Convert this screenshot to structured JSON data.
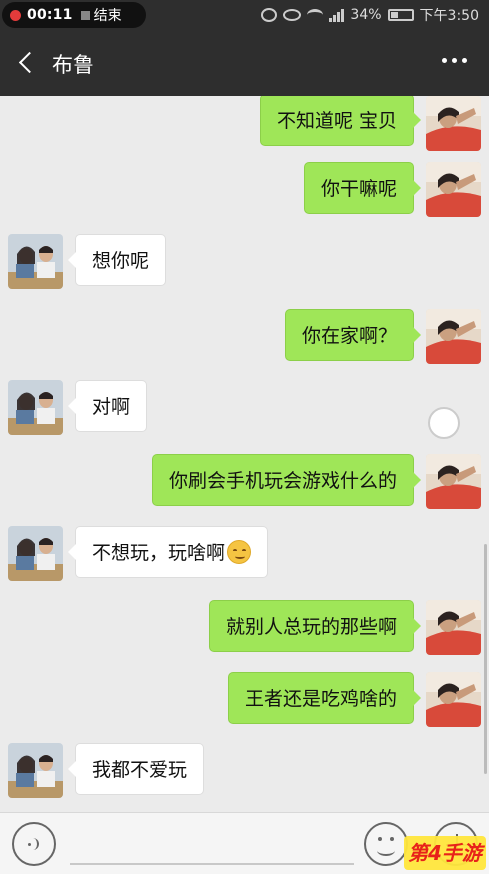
{
  "status_bar": {
    "recording_time": "00:11",
    "recording_end_label": "结束",
    "battery": "34%",
    "clock": "下午3:50",
    "icons": [
      "alarm-icon",
      "eye-icon",
      "wifi-icon",
      "signal-icon",
      "battery-icon"
    ]
  },
  "nav": {
    "title": "布鲁",
    "back_icon": "back-arrow-icon",
    "more_icon": "more-dots-icon"
  },
  "messages": [
    {
      "from": "me",
      "text": "不知道呢 宝贝"
    },
    {
      "from": "me",
      "text": "你干嘛呢"
    },
    {
      "from": "other",
      "text": "想你呢"
    },
    {
      "from": "me",
      "text": "你在家啊？"
    },
    {
      "from": "other",
      "text": "对啊"
    },
    {
      "from": "me",
      "text": "你刷会手机玩会游戏什么的"
    },
    {
      "from": "other",
      "text": "不想玩，玩啥啊",
      "emoji": "blush-smile-emoji"
    },
    {
      "from": "me",
      "text": "就别人总玩的那些啊"
    },
    {
      "from": "me",
      "text": "王者还是吃鸡啥的"
    },
    {
      "from": "other",
      "text": "我都不爱玩"
    }
  ],
  "input_bar": {
    "voice_icon": "voice-icon",
    "emoji_icon": "emoji-icon",
    "plus_icon": "plus-icon"
  },
  "watermark": "第4手游",
  "colors": {
    "topbar": "#2e2e2e",
    "chat_background": "#ebebeb",
    "my_bubble": "#9fe658",
    "other_bubble": "#ffffff",
    "watermark_text": "#e8221a"
  }
}
